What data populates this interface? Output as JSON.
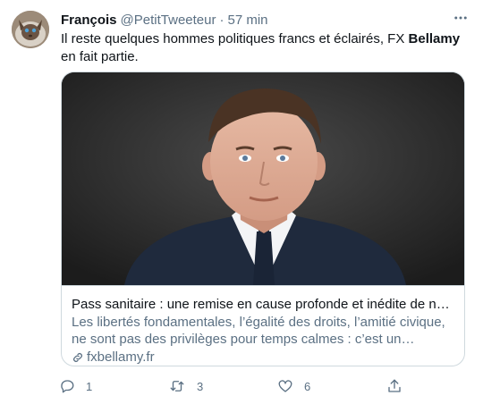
{
  "tweet": {
    "author_name": "François",
    "author_handle": "@PetitTweeteur",
    "separator": "·",
    "time": "57 min",
    "text_before": "Il reste quelques hommes politiques francs et éclairés, FX ",
    "text_bold": "Bellamy",
    "text_after": " en fait partie."
  },
  "card": {
    "title": "Pass sanitaire : une remise en cause profonde et inédite de notr…",
    "description": "Les libertés fondamentales, l’égalité des droits, l’amitié civique, ne sont pas des privilèges pour temps calmes : c’est un héritage…",
    "domain": "fxbellamy.fr"
  },
  "actions": {
    "reply_count": "1",
    "retweet_count": "3",
    "like_count": "6"
  },
  "icons": {
    "more": "more-dots-icon",
    "reply": "reply-icon",
    "retweet": "retweet-icon",
    "like": "heart-icon",
    "share": "share-icon",
    "link": "link-icon"
  },
  "colors": {
    "text": "#0f1419",
    "secondary": "#5b7083",
    "border": "#cfd9de"
  }
}
